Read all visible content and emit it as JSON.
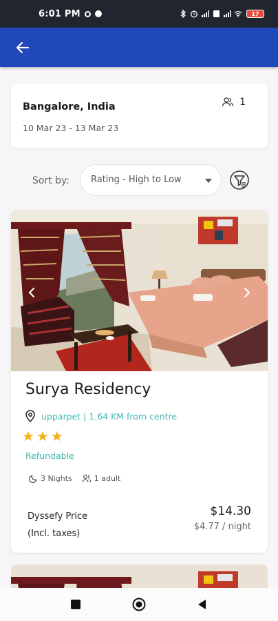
{
  "status_bar": {
    "time": "6:01 PM",
    "battery": "17"
  },
  "app_bar": {
    "back_icon": "arrow-left-icon"
  },
  "search": {
    "location": "Bangalore, India",
    "dates": "10 Mar 23 - 13 Mar 23",
    "guests": "1"
  },
  "sort": {
    "label": "Sort by:",
    "value": "Rating - High to Low"
  },
  "hotel": {
    "name": "Surya Residency",
    "location": "upparpet | 1.64 KM from centre",
    "stars": 3,
    "refundable": "Refundable",
    "nights": "3 Nights",
    "adults": "1 adult",
    "price_label_line1": "Dyssefy Price",
    "price_label_line2": "(Incl. taxes)",
    "price_total": "$14.30",
    "price_per_night": "$4.77 / night"
  },
  "colors": {
    "app_bar": "#2148b8",
    "accent_teal": "#3fb8af",
    "star": "#f2b115"
  }
}
